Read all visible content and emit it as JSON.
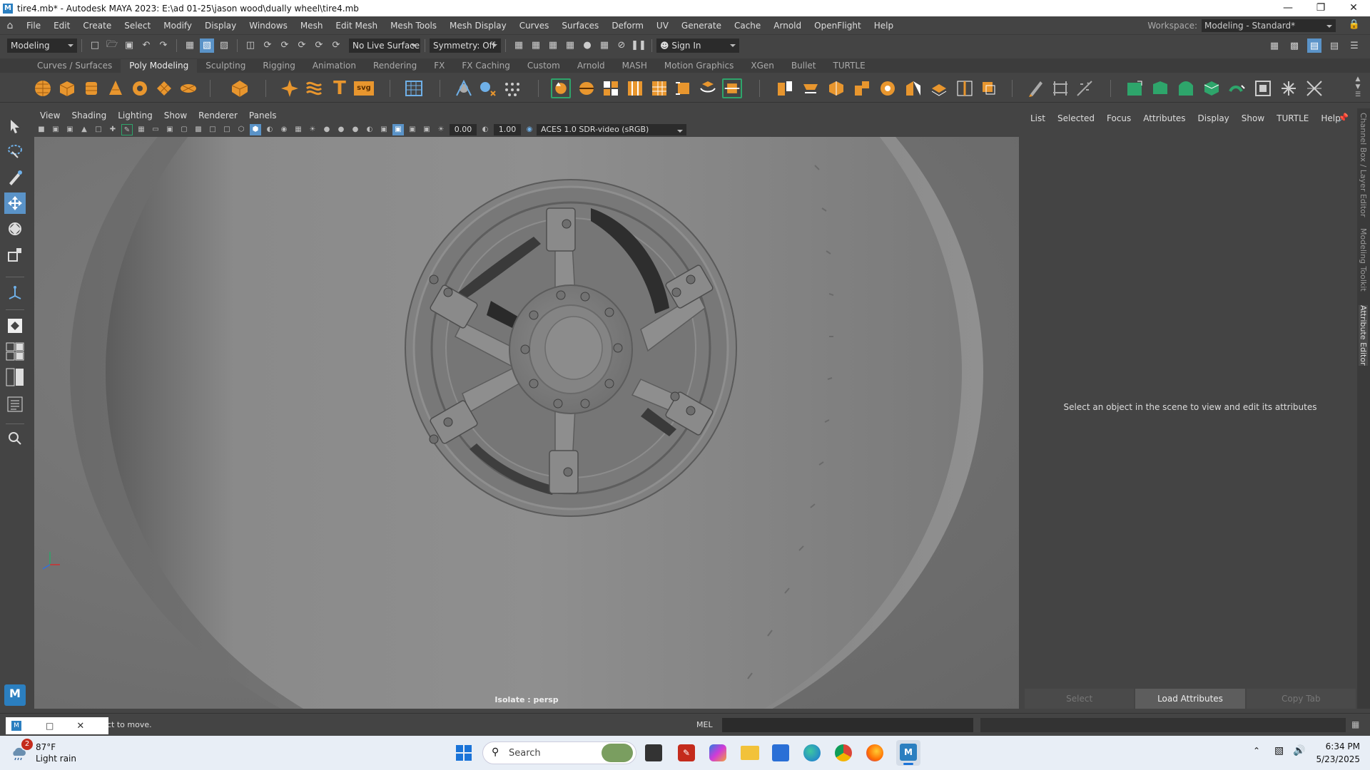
{
  "window": {
    "title": "tire4.mb* - Autodesk MAYA 2023: E:\\ad 01-25\\jason wood\\dually wheel\\tire4.mb",
    "app_icon": "maya-icon"
  },
  "menubar": {
    "items": [
      "File",
      "Edit",
      "Create",
      "Select",
      "Modify",
      "Display",
      "Windows",
      "Mesh",
      "Edit Mesh",
      "Mesh Tools",
      "Mesh Display",
      "Curves",
      "Surfaces",
      "Deform",
      "UV",
      "Generate",
      "Cache",
      "Arnold",
      "OpenFlight",
      "Help"
    ]
  },
  "workspace": {
    "label": "Workspace:",
    "value": "Modeling - Standard*"
  },
  "statusline": {
    "mode": "Modeling",
    "live_surface": "No Live Surface",
    "symmetry": "Symmetry: Off",
    "sign_in": "Sign In"
  },
  "shelf": {
    "tabs": [
      "Curves / Surfaces",
      "Poly Modeling",
      "Sculpting",
      "Rigging",
      "Animation",
      "Rendering",
      "FX",
      "FX Caching",
      "Custom",
      "Arnold",
      "MASH",
      "Motion Graphics",
      "XGen",
      "Bullet",
      "TURTLE"
    ],
    "active": "Poly Modeling"
  },
  "viewport": {
    "menus": [
      "View",
      "Shading",
      "Lighting",
      "Show",
      "Renderer",
      "Panels"
    ],
    "field_a": "0.00",
    "field_b": "1.00",
    "colorspace": "ACES 1.0 SDR-video (sRGB)",
    "status": "Isolate : persp"
  },
  "attribute_editor": {
    "tabs": [
      "List",
      "Selected",
      "Focus",
      "Attributes",
      "Display",
      "Show",
      "TURTLE",
      "Help"
    ],
    "message": "Select an object in the scene to view and edit its attributes",
    "buttons": [
      "Select",
      "Load Attributes",
      "Copy Tab"
    ]
  },
  "side_tabs": [
    "Channel Box / Layer Editor",
    "Modeling Toolkit",
    "Attribute Editor"
  ],
  "helpline": {
    "text": "ct to move.",
    "mel_label": "MEL"
  },
  "taskbar": {
    "weather_temp": "87°F",
    "weather_desc": "Light rain",
    "weather_badge": "2",
    "search": "Search",
    "time": "6:34 PM",
    "date": "5/23/2025"
  },
  "colors": {
    "accent_orange": "#e8962e",
    "active_blue": "#5a93c8",
    "shelf_green": "#2ea56b"
  }
}
